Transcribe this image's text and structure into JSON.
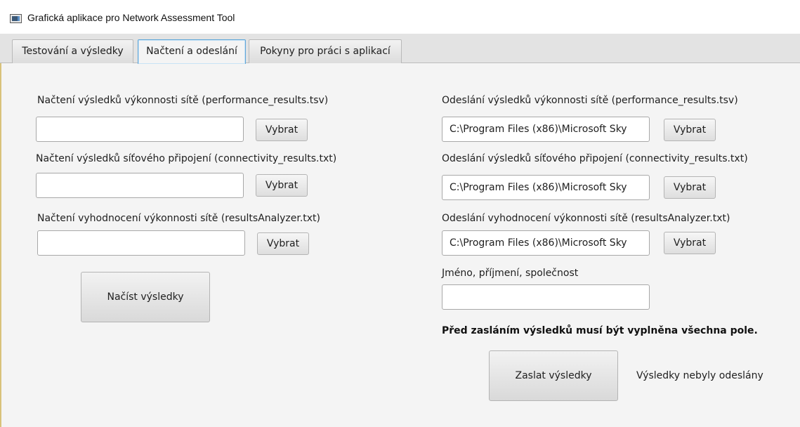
{
  "window": {
    "title": "Grafická aplikace pro Network Assessment Tool"
  },
  "tabs": [
    {
      "label": "Testování a výsledky",
      "active": false
    },
    {
      "label": "Načtení a odeslání",
      "active": true
    },
    {
      "label": "Pokyny pro práci s aplikací",
      "active": false
    }
  ],
  "load": {
    "performance_label": "Načtení výsledků výkonnosti sítě (performance_results.tsv)",
    "performance_value": "",
    "connectivity_label": "Načtení výsledků síťového připojení (connectivity_results.txt)",
    "connectivity_value": "",
    "analyzer_label": "Načtení vyhodnocení výkonnosti sítě (resultsAnalyzer.txt)",
    "analyzer_value": "",
    "choose_label": "Vybrat",
    "load_button": "Načíst výsledky"
  },
  "send": {
    "performance_label": "Odeslání výsledků výkonnosti sítě (performance_results.tsv)",
    "performance_value": "C:\\Program Files (x86)\\Microsoft Sky",
    "connectivity_label": "Odeslání výsledků síťového připojení (connectivity_results.txt)",
    "connectivity_value": "C:\\Program Files (x86)\\Microsoft Sky",
    "analyzer_label": "Odeslání vyhodnocení výkonnosti sítě (resultsAnalyzer.txt)",
    "analyzer_value": "C:\\Program Files (x86)\\Microsoft Sky",
    "choose_label": "Vybrat",
    "name_label": "Jméno, příjmení, společnost",
    "name_value": "",
    "warning": "Před zasláním výsledků musí být vyplněna všechna pole.",
    "send_button": "Zaslat výsledky",
    "status": "Výsledky nebyly odeslány"
  },
  "colors": {
    "active_tab_border": "#60a6d8",
    "background": "#f4f4f4"
  }
}
